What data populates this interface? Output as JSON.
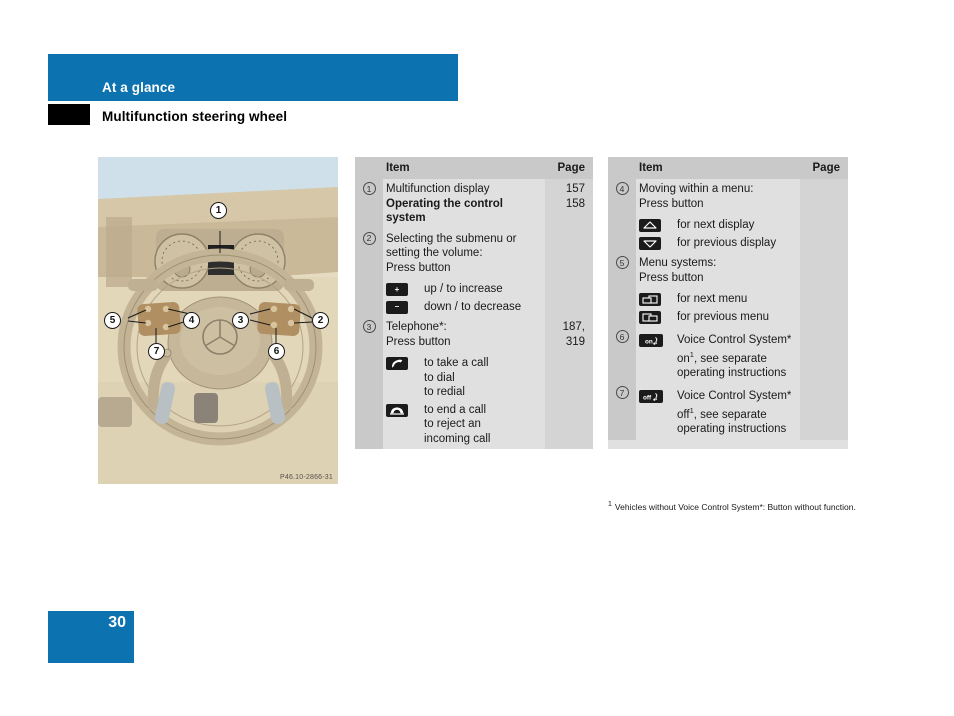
{
  "header": {
    "banner_title": "At a glance",
    "section_title": "Multifunction steering wheel"
  },
  "figure": {
    "caption": "P46.10-2866-31",
    "callouts": [
      "1",
      "2",
      "3",
      "4",
      "5",
      "6",
      "7"
    ]
  },
  "tables": [
    {
      "headers": {
        "item": "Item",
        "page": "Page"
      },
      "rows": [
        {
          "num": "1",
          "lines": [
            {
              "text": "Multifunction display",
              "bold": false
            },
            {
              "text": "Operating the control system",
              "bold": true
            }
          ],
          "pages": [
            "157",
            "158"
          ]
        },
        {
          "num": "2",
          "lines": [
            {
              "text": "Selecting the submenu or setting the volume:",
              "bold": false
            },
            {
              "text": "Press button",
              "bold": false
            }
          ],
          "pages": [],
          "icons": [
            {
              "glyph": "+",
              "label": "up / to increase"
            },
            {
              "glyph": "–",
              "label": "down / to decrease"
            }
          ]
        },
        {
          "num": "3",
          "lines": [
            {
              "text": "Telephone*:",
              "bold": false
            },
            {
              "text": "Press button",
              "bold": false
            }
          ],
          "pages": [
            "187,",
            "319"
          ],
          "icons": [
            {
              "glyph": "phone-offhook",
              "label": "to take a call\nto dial\nto redial"
            },
            {
              "glyph": "phone-onhook",
              "label": "to end a call\nto reject an\nincoming call"
            }
          ]
        }
      ]
    },
    {
      "headers": {
        "item": "Item",
        "page": "Page"
      },
      "rows": [
        {
          "num": "4",
          "lines": [
            {
              "text": "Moving within a menu:",
              "bold": false
            },
            {
              "text": "Press button",
              "bold": false
            }
          ],
          "pages": [],
          "icons": [
            {
              "glyph": "triangle-up",
              "label": "for next display"
            },
            {
              "glyph": "triangle-down",
              "label": "for previous display"
            }
          ]
        },
        {
          "num": "5",
          "lines": [
            {
              "text": "Menu systems:",
              "bold": false
            },
            {
              "text": "Press button",
              "bold": false
            }
          ],
          "pages": [],
          "icons": [
            {
              "glyph": "menu-next",
              "label": "for next menu"
            },
            {
              "glyph": "menu-prev",
              "label": "for previous menu"
            }
          ]
        },
        {
          "num": "6",
          "lines": [],
          "pages": [],
          "icons": [
            {
              "glyph": "voice-on",
              "label": "Voice Control System* on¹, see separate operating instructions"
            }
          ]
        },
        {
          "num": "7",
          "lines": [],
          "pages": [],
          "icons": [
            {
              "glyph": "voice-off",
              "label": "Voice Control System* off¹, see separate operating instructions"
            }
          ]
        }
      ]
    }
  ],
  "footnote": {
    "mark": "1",
    "text": "Vehicles without Voice Control System*: Button without function."
  },
  "footer": {
    "page_number": "30"
  },
  "colors": {
    "brand_blue": "#0d72b0",
    "table_header_gray": "#c9c9c9",
    "table_body_gray": "#e0e0e0",
    "page_col_gray": "#d4d4d4",
    "icon_black": "#1b1b1b"
  }
}
